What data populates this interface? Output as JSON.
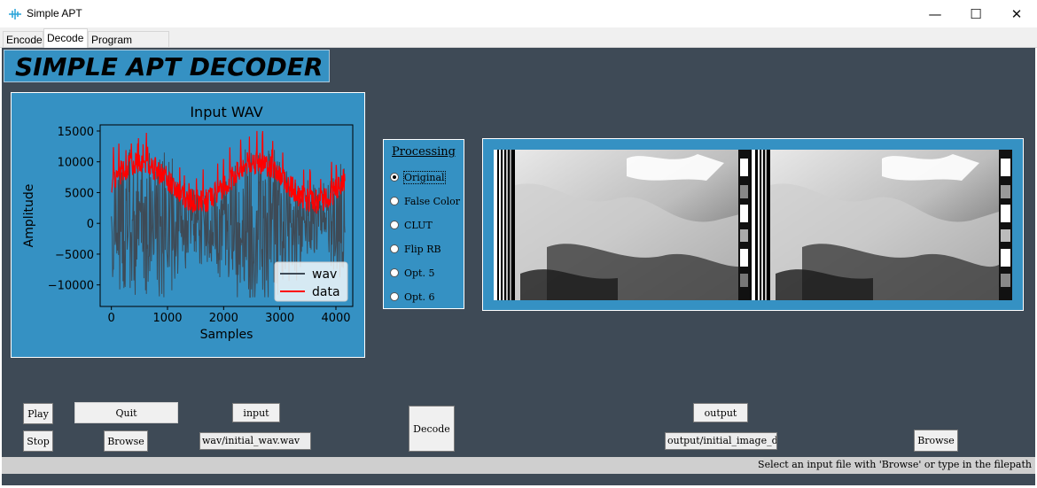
{
  "window": {
    "title": "Simple APT",
    "minimize": "—",
    "maximize": "☐",
    "close": "✕"
  },
  "tabs": [
    {
      "label": "Encode"
    },
    {
      "label": "Decode",
      "active": true
    },
    {
      "label": "Program Output"
    }
  ],
  "banner": {
    "title": "SIMPLE APT DECODER"
  },
  "chart_data": {
    "type": "line",
    "title": "Input WAV",
    "xlabel": "Samples",
    "ylabel": "Amplitude",
    "xlim": [
      -200,
      4300
    ],
    "ylim": [
      -13500,
      16000
    ],
    "xticks": [
      0,
      1000,
      2000,
      3000,
      4000
    ],
    "yticks": [
      -10000,
      -5000,
      0,
      5000,
      10000,
      15000
    ],
    "xtick_labels": [
      "0",
      "1000",
      "2000",
      "3000",
      "4000"
    ],
    "ytick_labels": [
      "−10000",
      "−5000",
      "0",
      "5000",
      "10000",
      "15000"
    ],
    "legend_position": "lower-right",
    "series": [
      {
        "name": "wav",
        "color": "#3e4a56",
        "x_range": [
          0,
          4160
        ],
        "y_range": [
          -12000,
          12000
        ]
      },
      {
        "name": "data",
        "color": "#ff0000",
        "x_range": [
          0,
          4160
        ],
        "y_range": [
          0,
          15000
        ]
      }
    ],
    "grid": false
  },
  "processing": {
    "title": "Processing",
    "options": [
      {
        "label": "Original",
        "selected": true
      },
      {
        "label": "False Color",
        "selected": false
      },
      {
        "label": "CLUT",
        "selected": false
      },
      {
        "label": "Flip RB",
        "selected": false
      },
      {
        "label": "Opt. 5",
        "selected": false
      },
      {
        "label": "Opt. 6",
        "selected": false
      }
    ]
  },
  "controls": {
    "play": "Play",
    "stop": "Stop",
    "quit": "Quit",
    "browse_input": "Browse",
    "input_label": "input",
    "input_value": "wav/initial_wav.wav",
    "decode": "Decode",
    "output_label": "output",
    "output_value": "output/initial_image_d",
    "browse_output": "Browse"
  },
  "status": {
    "text": "Select an input file with 'Browse' or type in the filepath"
  }
}
